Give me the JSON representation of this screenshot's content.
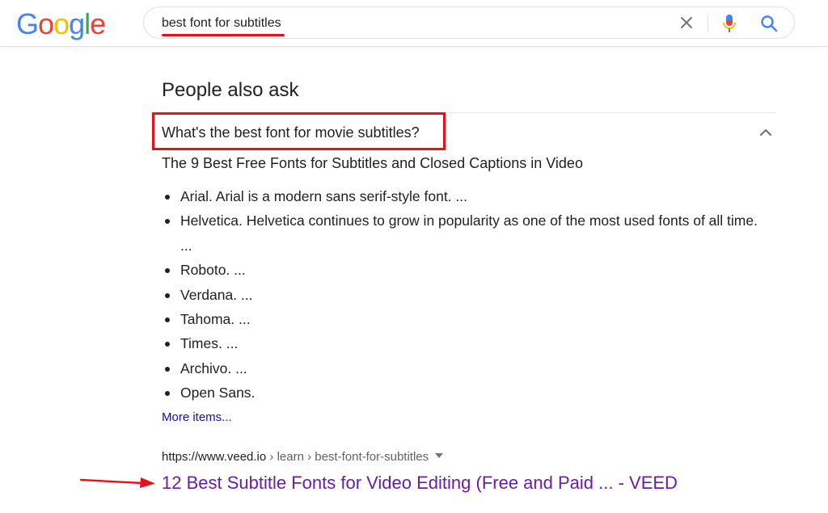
{
  "header": {
    "logo_letters": [
      "G",
      "o",
      "o",
      "g",
      "l",
      "e"
    ],
    "logo_colors": [
      "#4285f4",
      "#ea4335",
      "#fbbc05",
      "#4285f4",
      "#34a853",
      "#ea4335"
    ],
    "search_value": "best font for subtitles"
  },
  "paa": {
    "title": "People also ask",
    "question": "What's the best font for movie subtitles?",
    "answer_heading": "The 9 Best Free Fonts for Subtitles and Closed Captions in Video",
    "items": [
      "Arial. Arial is a modern sans serif-style font. ...",
      "Helvetica. Helvetica continues to grow in popularity as one of the most used fonts of all time. ...",
      "Roboto. ...",
      "Verdana. ...",
      "Tahoma. ...",
      "Times. ...",
      "Archivo. ...",
      "Open Sans."
    ],
    "more_items": "More items..."
  },
  "result": {
    "url_domain": "https://www.veed.io",
    "url_crumbs": " › learn › best-font-for-subtitles",
    "title": "12 Best Subtitle Fonts for Video Editing (Free and Paid ... - VEED"
  },
  "colors": {
    "annotation_red": "#e8111a",
    "link_blue": "#1a0dab",
    "visited_purple": "#681da8"
  }
}
